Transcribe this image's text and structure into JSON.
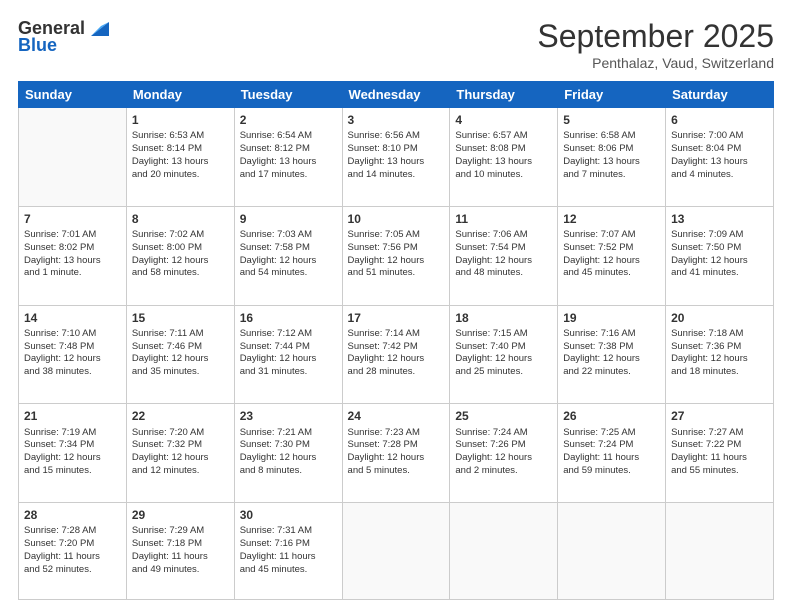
{
  "header": {
    "logo_general": "General",
    "logo_blue": "Blue",
    "month_title": "September 2025",
    "location": "Penthalaz, Vaud, Switzerland"
  },
  "days_of_week": [
    "Sunday",
    "Monday",
    "Tuesday",
    "Wednesday",
    "Thursday",
    "Friday",
    "Saturday"
  ],
  "weeks": [
    [
      {
        "day": "",
        "content": ""
      },
      {
        "day": "1",
        "content": "Sunrise: 6:53 AM\nSunset: 8:14 PM\nDaylight: 13 hours\nand 20 minutes."
      },
      {
        "day": "2",
        "content": "Sunrise: 6:54 AM\nSunset: 8:12 PM\nDaylight: 13 hours\nand 17 minutes."
      },
      {
        "day": "3",
        "content": "Sunrise: 6:56 AM\nSunset: 8:10 PM\nDaylight: 13 hours\nand 14 minutes."
      },
      {
        "day": "4",
        "content": "Sunrise: 6:57 AM\nSunset: 8:08 PM\nDaylight: 13 hours\nand 10 minutes."
      },
      {
        "day": "5",
        "content": "Sunrise: 6:58 AM\nSunset: 8:06 PM\nDaylight: 13 hours\nand 7 minutes."
      },
      {
        "day": "6",
        "content": "Sunrise: 7:00 AM\nSunset: 8:04 PM\nDaylight: 13 hours\nand 4 minutes."
      }
    ],
    [
      {
        "day": "7",
        "content": "Sunrise: 7:01 AM\nSunset: 8:02 PM\nDaylight: 13 hours\nand 1 minute."
      },
      {
        "day": "8",
        "content": "Sunrise: 7:02 AM\nSunset: 8:00 PM\nDaylight: 12 hours\nand 58 minutes."
      },
      {
        "day": "9",
        "content": "Sunrise: 7:03 AM\nSunset: 7:58 PM\nDaylight: 12 hours\nand 54 minutes."
      },
      {
        "day": "10",
        "content": "Sunrise: 7:05 AM\nSunset: 7:56 PM\nDaylight: 12 hours\nand 51 minutes."
      },
      {
        "day": "11",
        "content": "Sunrise: 7:06 AM\nSunset: 7:54 PM\nDaylight: 12 hours\nand 48 minutes."
      },
      {
        "day": "12",
        "content": "Sunrise: 7:07 AM\nSunset: 7:52 PM\nDaylight: 12 hours\nand 45 minutes."
      },
      {
        "day": "13",
        "content": "Sunrise: 7:09 AM\nSunset: 7:50 PM\nDaylight: 12 hours\nand 41 minutes."
      }
    ],
    [
      {
        "day": "14",
        "content": "Sunrise: 7:10 AM\nSunset: 7:48 PM\nDaylight: 12 hours\nand 38 minutes."
      },
      {
        "day": "15",
        "content": "Sunrise: 7:11 AM\nSunset: 7:46 PM\nDaylight: 12 hours\nand 35 minutes."
      },
      {
        "day": "16",
        "content": "Sunrise: 7:12 AM\nSunset: 7:44 PM\nDaylight: 12 hours\nand 31 minutes."
      },
      {
        "day": "17",
        "content": "Sunrise: 7:14 AM\nSunset: 7:42 PM\nDaylight: 12 hours\nand 28 minutes."
      },
      {
        "day": "18",
        "content": "Sunrise: 7:15 AM\nSunset: 7:40 PM\nDaylight: 12 hours\nand 25 minutes."
      },
      {
        "day": "19",
        "content": "Sunrise: 7:16 AM\nSunset: 7:38 PM\nDaylight: 12 hours\nand 22 minutes."
      },
      {
        "day": "20",
        "content": "Sunrise: 7:18 AM\nSunset: 7:36 PM\nDaylight: 12 hours\nand 18 minutes."
      }
    ],
    [
      {
        "day": "21",
        "content": "Sunrise: 7:19 AM\nSunset: 7:34 PM\nDaylight: 12 hours\nand 15 minutes."
      },
      {
        "day": "22",
        "content": "Sunrise: 7:20 AM\nSunset: 7:32 PM\nDaylight: 12 hours\nand 12 minutes."
      },
      {
        "day": "23",
        "content": "Sunrise: 7:21 AM\nSunset: 7:30 PM\nDaylight: 12 hours\nand 8 minutes."
      },
      {
        "day": "24",
        "content": "Sunrise: 7:23 AM\nSunset: 7:28 PM\nDaylight: 12 hours\nand 5 minutes."
      },
      {
        "day": "25",
        "content": "Sunrise: 7:24 AM\nSunset: 7:26 PM\nDaylight: 12 hours\nand 2 minutes."
      },
      {
        "day": "26",
        "content": "Sunrise: 7:25 AM\nSunset: 7:24 PM\nDaylight: 11 hours\nand 59 minutes."
      },
      {
        "day": "27",
        "content": "Sunrise: 7:27 AM\nSunset: 7:22 PM\nDaylight: 11 hours\nand 55 minutes."
      }
    ],
    [
      {
        "day": "28",
        "content": "Sunrise: 7:28 AM\nSunset: 7:20 PM\nDaylight: 11 hours\nand 52 minutes."
      },
      {
        "day": "29",
        "content": "Sunrise: 7:29 AM\nSunset: 7:18 PM\nDaylight: 11 hours\nand 49 minutes."
      },
      {
        "day": "30",
        "content": "Sunrise: 7:31 AM\nSunset: 7:16 PM\nDaylight: 11 hours\nand 45 minutes."
      },
      {
        "day": "",
        "content": ""
      },
      {
        "day": "",
        "content": ""
      },
      {
        "day": "",
        "content": ""
      },
      {
        "day": "",
        "content": ""
      }
    ]
  ]
}
